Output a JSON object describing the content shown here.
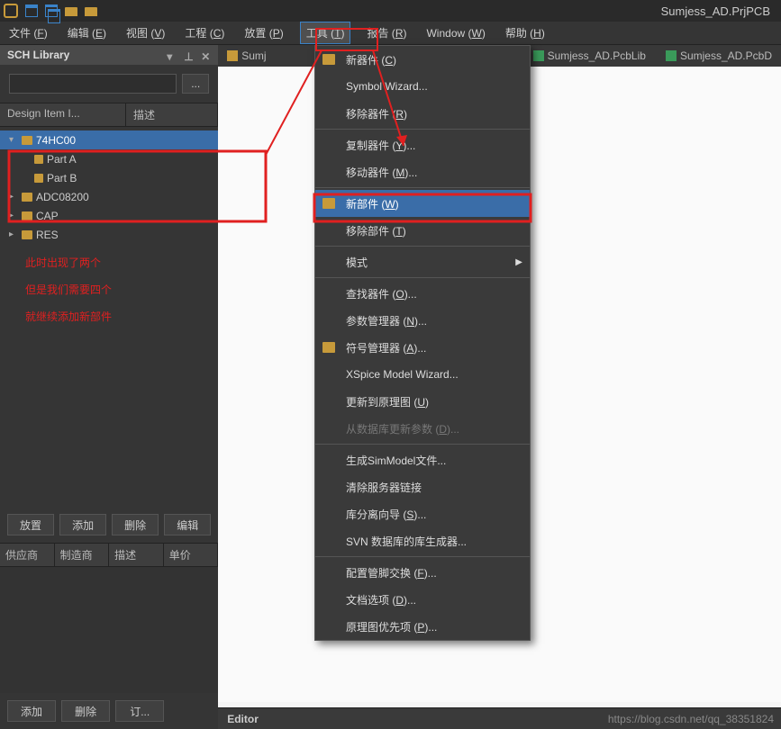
{
  "title": "Sumjess_AD.PrjPCB",
  "menu": [
    {
      "l": "文件",
      "k": "F"
    },
    {
      "l": "编辑",
      "k": "E"
    },
    {
      "l": "视图",
      "k": "V"
    },
    {
      "l": "工程",
      "k": "C"
    },
    {
      "l": "放置",
      "k": "P"
    },
    {
      "l": "工具",
      "k": "T"
    },
    {
      "l": "报告",
      "k": "R"
    },
    {
      "l": "Window",
      "k": "W"
    },
    {
      "l": "帮助",
      "k": "H"
    }
  ],
  "panel": {
    "title": "SCH Library",
    "cols": [
      "Design Item I...",
      "描述"
    ],
    "tree": [
      {
        "label": "74HC00",
        "sel": true,
        "exp": true,
        "children": [
          {
            "label": "Part A"
          },
          {
            "label": "Part B"
          }
        ]
      },
      {
        "label": "ADC08200"
      },
      {
        "label": "CAP"
      },
      {
        "label": "RES"
      }
    ],
    "btns1": [
      "放置",
      "添加",
      "删除",
      "编辑"
    ],
    "cols2": [
      "供应商",
      "制造商",
      "描述",
      "单价"
    ],
    "btns2": [
      "添加",
      "删除",
      "订..."
    ]
  },
  "tabs": [
    {
      "label": "Sumj",
      "icon": "y"
    },
    {
      "label": "Sumjess_AD.PcbLib",
      "icon": "g"
    },
    {
      "label": "Sumjess_AD.PcbD",
      "icon": "g"
    }
  ],
  "dropdown": [
    {
      "t": "新器件 (C)",
      "i": true
    },
    {
      "t": "Symbol Wizard..."
    },
    {
      "t": "移除器件 (R)"
    },
    {
      "s": true
    },
    {
      "t": "复制器件 (Y)..."
    },
    {
      "t": "移动器件 (M)..."
    },
    {
      "s": true
    },
    {
      "t": "新部件 (W)",
      "i": true,
      "sel": true
    },
    {
      "t": "移除部件 (T)"
    },
    {
      "s": true
    },
    {
      "t": "模式",
      "arr": true
    },
    {
      "s": true
    },
    {
      "t": "查找器件 (O)..."
    },
    {
      "t": "参数管理器 (N)..."
    },
    {
      "t": "符号管理器 (A)...",
      "i": true
    },
    {
      "t": "XSpice Model Wizard..."
    },
    {
      "t": "更新到原理图 (U)"
    },
    {
      "t": "从数据库更新参数 (D)...",
      "dis": true
    },
    {
      "s": true
    },
    {
      "t": "生成SimModel文件..."
    },
    {
      "t": "清除服务器链接"
    },
    {
      "t": "库分离向导 (S)..."
    },
    {
      "t": "SVN 数据库的库生成器..."
    },
    {
      "s": true
    },
    {
      "t": "配置管脚交换 (F)..."
    },
    {
      "t": "文档选项 (D)..."
    },
    {
      "t": "原理图优先项 (P)..."
    }
  ],
  "annot": [
    "此时出现了两个",
    "但是我们需要四个",
    "就继续添加新部件"
  ],
  "editor": "Editor",
  "watermark": "https://blog.csdn.net/qq_38351824"
}
